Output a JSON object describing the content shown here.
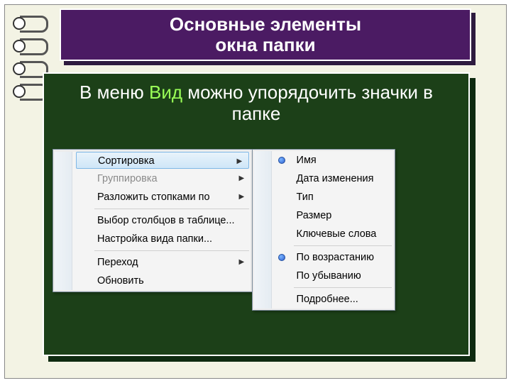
{
  "title": {
    "line1": "Основные элементы",
    "line2": "окна папки"
  },
  "body": {
    "prefix": "В меню ",
    "highlight": "Вид",
    "suffix": " можно упорядочить значки в папке"
  },
  "menu_main": {
    "items": [
      {
        "label": "Сортировка",
        "submenu": true,
        "disabled": false,
        "highlight": true
      },
      {
        "label": "Группировка",
        "submenu": true,
        "disabled": true
      },
      {
        "label": "Разложить стопками по",
        "submenu": true,
        "disabled": false
      }
    ],
    "items2": [
      {
        "label": "Выбор столбцов в таблице..."
      },
      {
        "label": "Настройка вида папки..."
      }
    ],
    "items3": [
      {
        "label": "Переход",
        "submenu": true
      },
      {
        "label": "Обновить"
      }
    ]
  },
  "menu_sub": {
    "group1": [
      {
        "label": "Имя",
        "radio": true
      },
      {
        "label": "Дата изменения"
      },
      {
        "label": "Тип"
      },
      {
        "label": "Размер"
      },
      {
        "label": "Ключевые слова"
      }
    ],
    "group2": [
      {
        "label": "По возрастанию",
        "radio": true
      },
      {
        "label": "По убыванию"
      }
    ],
    "group3": [
      {
        "label": "Подробнее..."
      }
    ]
  }
}
